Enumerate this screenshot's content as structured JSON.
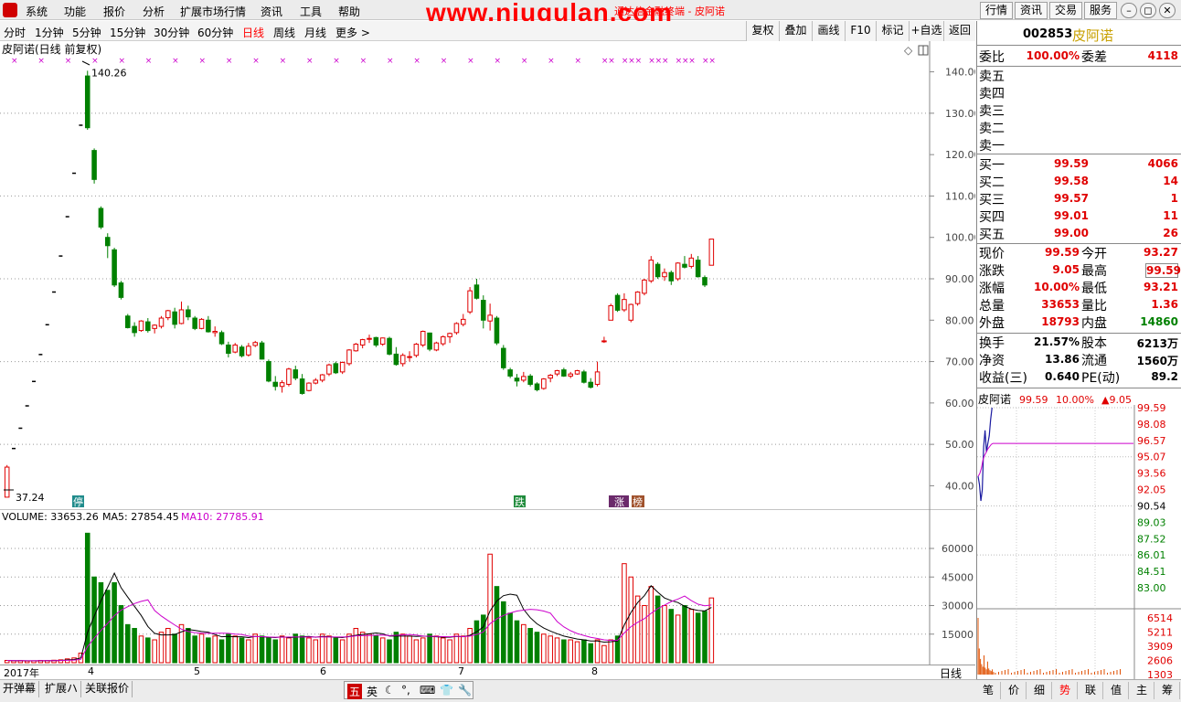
{
  "menubar": {
    "logo_icon": "app-logo-icon",
    "items": [
      "系统",
      "功能",
      "报价",
      "分析",
      "扩展市场行情",
      "资讯",
      "工具",
      "帮助"
    ],
    "watermark": "www.niugulan.com",
    "title_fragment": "通达信金融终端 - 皮阿诺",
    "right_buttons": [
      "行情",
      "资讯",
      "交易",
      "服务"
    ]
  },
  "periodbar": {
    "periods": [
      "分时",
      "1分钟",
      "5分钟",
      "15分钟",
      "30分钟",
      "60分钟",
      "日线",
      "周线",
      "月线",
      "更多 >"
    ],
    "active": "日线",
    "tools": [
      "复权",
      "叠加",
      "画线",
      "F10",
      "标记",
      "+自选",
      "返回"
    ]
  },
  "chart_header": {
    "title": "皮阿诺(日线 前复权)",
    "high_label": "140.26",
    "low_label": "37.24",
    "event_markers": [
      "停",
      "跌",
      "涨",
      "榜"
    ]
  },
  "price_axis": [
    "140.00",
    "130.00",
    "120.00",
    "110.00",
    "100.00",
    "90.00",
    "80.00",
    "70.00",
    "60.00",
    "50.00",
    "40.00"
  ],
  "volume_header": {
    "volume_label": "VOLUME: 33653.26",
    "ma5_label": "MA5: 27854.45",
    "ma10_label": "MA10: 27785.91"
  },
  "volume_axis": [
    "60000",
    "45000",
    "30000",
    "15000"
  ],
  "time_axis": {
    "labels": [
      "2017年",
      "4",
      "5",
      "6",
      "7",
      "8"
    ],
    "period_label": "日线"
  },
  "bottom_tabs": [
    "开弹幕",
    "扩展ハ",
    "关联报价"
  ],
  "ime_bar": {
    "items": [
      "五",
      "英"
    ]
  },
  "quote_panel": {
    "code": "002853",
    "name": "皮阿诺",
    "weibi_label": "委比",
    "weibi": "100.00%",
    "weicha_label": "委差",
    "weicha": "4118",
    "asks": [
      {
        "label": "卖五",
        "price": "",
        "vol": ""
      },
      {
        "label": "卖四",
        "price": "",
        "vol": ""
      },
      {
        "label": "卖三",
        "price": "",
        "vol": ""
      },
      {
        "label": "卖二",
        "price": "",
        "vol": ""
      },
      {
        "label": "卖一",
        "price": "",
        "vol": ""
      }
    ],
    "bids": [
      {
        "label": "买一",
        "price": "99.59",
        "vol": "4066"
      },
      {
        "label": "买二",
        "price": "99.58",
        "vol": "14"
      },
      {
        "label": "买三",
        "price": "99.57",
        "vol": "1"
      },
      {
        "label": "买四",
        "price": "99.01",
        "vol": "11"
      },
      {
        "label": "买五",
        "price": "99.00",
        "vol": "26"
      }
    ],
    "stats": [
      {
        "l1": "现价",
        "v1": "99.59",
        "l2": "今开",
        "v2": "93.27"
      },
      {
        "l1": "涨跌",
        "v1": "9.05",
        "l2": "最高",
        "v2": "99.59"
      },
      {
        "l1": "涨幅",
        "v1": "10.00%",
        "l2": "最低",
        "v2": "93.21"
      },
      {
        "l1": "总量",
        "v1": "33653",
        "l2": "量比",
        "v2": "1.36"
      },
      {
        "l1": "外盘",
        "v1": "18793",
        "l2": "内盘",
        "v2": "14860"
      }
    ],
    "stats2": [
      {
        "l1": "换手",
        "v1": "21.57%",
        "l2": "股本",
        "v2": "6213万"
      },
      {
        "l1": "净资",
        "v1": "13.86",
        "l2": "流通",
        "v2": "1560万"
      },
      {
        "l1": "收益(三)",
        "v1": "0.640",
        "l2": "PE(动)",
        "v2": "89.2"
      }
    ],
    "mini_header": {
      "name": "皮阿诺",
      "price": "99.59",
      "pct": "10.00%",
      "change": "▲9.05"
    },
    "mini_price_axis": [
      "99.59",
      "98.08",
      "96.57",
      "95.07",
      "93.56",
      "92.05",
      "90.54",
      "89.03",
      "87.52",
      "86.01",
      "84.51",
      "83.00"
    ],
    "mini_vol_axis": [
      "6514",
      "5211",
      "3909",
      "2606",
      "1303"
    ],
    "tabs": [
      "笔",
      "价",
      "细",
      "势",
      "联",
      "值",
      "主",
      "筹"
    ],
    "active_tab": "势"
  },
  "chart_data": {
    "type": "candlestick",
    "title": "皮阿诺(日线 前复权)",
    "ylim": [
      37,
      143
    ],
    "volume_ylim": [
      0,
      72000
    ],
    "ohlc": [
      [
        37.24,
        45,
        37.24,
        44.5
      ],
      [
        44.5,
        49,
        44.5,
        49
      ],
      [
        49,
        53.9,
        49,
        53.9
      ],
      [
        53.9,
        59.3,
        53.9,
        59.3
      ],
      [
        59.3,
        65.2,
        59.3,
        65.2
      ],
      [
        65.2,
        71.7,
        65.2,
        71.7
      ],
      [
        71.7,
        78.9,
        71.7,
        78.9
      ],
      [
        78.9,
        86.8,
        78.9,
        86.8
      ],
      [
        86.8,
        95.5,
        86.8,
        95.5
      ],
      [
        95.5,
        105,
        95.5,
        105
      ],
      [
        105,
        115.5,
        105,
        115.5
      ],
      [
        115.5,
        127.1,
        115.5,
        127.1
      ],
      [
        139,
        140.26,
        126,
        126.5
      ],
      [
        121,
        121.5,
        113,
        114
      ],
      [
        107,
        107.5,
        102,
        102.5
      ],
      [
        100,
        101,
        95,
        98
      ],
      [
        97,
        97.5,
        88,
        88.5
      ],
      [
        89,
        89.5,
        85,
        85.5
      ],
      [
        81,
        81.5,
        78,
        78.2
      ],
      [
        78.5,
        79.5,
        76,
        77
      ],
      [
        77.5,
        80,
        77.2,
        79.8
      ],
      [
        79.6,
        80.5,
        77,
        77.5
      ],
      [
        78,
        79,
        76.8,
        78.8
      ],
      [
        78.5,
        81,
        78,
        80.5
      ],
      [
        80.6,
        82.5,
        80,
        82.3
      ],
      [
        82,
        83,
        78,
        79
      ],
      [
        79.2,
        84.5,
        79,
        82.5
      ],
      [
        82.5,
        83.5,
        80,
        80.8
      ],
      [
        80.5,
        81,
        77.6,
        78
      ],
      [
        78,
        80.5,
        77.8,
        80.2
      ],
      [
        80,
        81,
        77,
        77.2
      ],
      [
        77,
        78.5,
        76,
        77.3
      ],
      [
        77,
        77.5,
        74,
        74.3
      ],
      [
        74,
        74.8,
        71,
        72
      ],
      [
        72.3,
        74.5,
        72,
        74
      ],
      [
        73.5,
        74,
        71,
        71.4
      ],
      [
        71.6,
        74.5,
        71.2,
        73.7
      ],
      [
        73.9,
        75,
        73.5,
        74.6
      ],
      [
        74.5,
        75,
        70.5,
        70.6
      ],
      [
        70,
        70.5,
        65,
        65.3
      ],
      [
        65,
        66.5,
        63,
        64
      ],
      [
        64,
        65.5,
        62.5,
        64.9
      ],
      [
        64.5,
        68.5,
        64,
        68.2
      ],
      [
        68,
        69,
        65.5,
        66
      ],
      [
        65.8,
        67,
        62,
        62.3
      ],
      [
        63,
        65,
        62.8,
        64.8
      ],
      [
        64.8,
        66,
        64.5,
        65.5
      ],
      [
        65.5,
        67,
        65,
        66.8
      ],
      [
        67,
        69.5,
        66.5,
        69.2
      ],
      [
        69.5,
        70,
        67,
        67.3
      ],
      [
        67.5,
        70,
        67,
        69.8
      ],
      [
        69.5,
        73,
        69,
        72.8
      ],
      [
        72.6,
        74.5,
        72.4,
        74.2
      ],
      [
        74,
        75.5,
        73.2,
        75.3
      ],
      [
        75.5,
        76.5,
        74.5,
        75.6
      ],
      [
        75.8,
        76,
        73.5,
        74
      ],
      [
        74.2,
        75.8,
        73.8,
        75.7
      ],
      [
        75.6,
        76,
        71.5,
        71.8
      ],
      [
        71.8,
        73.5,
        69,
        69.3
      ],
      [
        69.5,
        72,
        68.8,
        71.5
      ],
      [
        71,
        72.5,
        70,
        71.2
      ],
      [
        71.5,
        74.5,
        71,
        74.2
      ],
      [
        74,
        77.5,
        73.5,
        77.3
      ],
      [
        76.9,
        77,
        72.5,
        73
      ],
      [
        72.8,
        74.8,
        72.5,
        74.5
      ],
      [
        74.3,
        76.3,
        73.8,
        76
      ],
      [
        76,
        77,
        74.5,
        76.8
      ],
      [
        77,
        79.5,
        76.5,
        79.2
      ],
      [
        79,
        81.5,
        78.5,
        80.2
      ],
      [
        82,
        88,
        81.5,
        87.1
      ],
      [
        88.5,
        90,
        85,
        85.3
      ],
      [
        84.8,
        86,
        78,
        80
      ],
      [
        79.8,
        84,
        77.5,
        81.2
      ],
      [
        80.5,
        81,
        74,
        74.5
      ],
      [
        73.2,
        74,
        68,
        68.5
      ],
      [
        68,
        68.5,
        66,
        66.5
      ],
      [
        66,
        67,
        64,
        65.3
      ],
      [
        65.5,
        67.5,
        65,
        66.4
      ],
      [
        66.5,
        67,
        64,
        64.5
      ],
      [
        64.6,
        65,
        62.8,
        63.2
      ],
      [
        63.5,
        66,
        63.2,
        65.8
      ],
      [
        66,
        67,
        65,
        66.7
      ],
      [
        67,
        68,
        66.5,
        67.8
      ],
      [
        68,
        68.5,
        66.3,
        66.5
      ],
      [
        66.5,
        67.5,
        66,
        67
      ],
      [
        67,
        68,
        66.8,
        67.8
      ],
      [
        67.5,
        68,
        64.7,
        65
      ],
      [
        65,
        66,
        63.5,
        63.8
      ],
      [
        64.5,
        70,
        64,
        67.5
      ],
      [
        75,
        76,
        74.5,
        75
      ],
      [
        80,
        84,
        80,
        83.5
      ],
      [
        86,
        86.5,
        82,
        82.4
      ],
      [
        82.5,
        86.5,
        82,
        85
      ],
      [
        80,
        84,
        79.5,
        83.8
      ],
      [
        84,
        87,
        83.5,
        86.8
      ],
      [
        86.5,
        90,
        86,
        89.7
      ],
      [
        89.5,
        95.5,
        89,
        94.5
      ],
      [
        93.5,
        94,
        90,
        90.5
      ],
      [
        90.5,
        92.5,
        89.5,
        91.5
      ],
      [
        91.5,
        92,
        88.5,
        89.5
      ],
      [
        90,
        94,
        89.5,
        93.8
      ],
      [
        93.5,
        95.5,
        92.5,
        92.8
      ],
      [
        93,
        96,
        92.5,
        95
      ],
      [
        94.5,
        95.5,
        90.3,
        90.5
      ],
      [
        90.3,
        90.8,
        88,
        88.5
      ],
      [
        93.27,
        99.59,
        93.21,
        99.59
      ]
    ],
    "volume": [
      1200,
      1000,
      1100,
      900,
      1000,
      1200,
      1100,
      1300,
      1500,
      2000,
      2500,
      5000,
      68000,
      45000,
      42000,
      38000,
      42000,
      30000,
      20000,
      18000,
      14000,
      13000,
      12000,
      16000,
      18000,
      15000,
      20000,
      18000,
      14000,
      15000,
      13000,
      14000,
      12000,
      15000,
      14000,
      13000,
      12000,
      15000,
      14000,
      13000,
      12000,
      14000,
      13000,
      15000,
      14000,
      13000,
      12000,
      15000,
      14000,
      13000,
      12000,
      15000,
      18000,
      16000,
      15000,
      14000,
      13000,
      12000,
      16000,
      15000,
      14000,
      12000,
      13000,
      15000,
      14000,
      13000,
      12000,
      15000,
      14000,
      18000,
      22000,
      25000,
      57000,
      40000,
      32000,
      26000,
      22000,
      20000,
      18000,
      16000,
      15000,
      14000,
      13000,
      12000,
      12000,
      11000,
      12000,
      10000,
      12000,
      9000,
      12000,
      14000,
      52000,
      45000,
      35000,
      30000,
      40000,
      35000,
      30000,
      28000,
      25000,
      30000,
      28000,
      26000,
      27000,
      34000
    ],
    "ma5_note": "",
    "price_ticks": [
      140,
      130,
      120,
      110,
      100,
      90,
      80,
      70,
      60,
      50,
      40
    ],
    "volume_ticks": [
      60000,
      45000,
      30000,
      15000
    ],
    "intraday": {
      "ylim": [
        83.0,
        99.59
      ],
      "price_line": [
        93.27,
        92.5,
        91.0,
        92.0,
        96.0,
        97.5,
        95.5,
        96.3,
        97.0,
        98.5,
        99.59
      ],
      "avg_line": [
        93.27,
        93.5,
        94.0,
        94.8,
        95.2,
        95.5,
        95.8,
        96.0,
        96.2,
        96.3
      ],
      "volume": [
        6514,
        3000,
        1800,
        1200,
        900,
        2200,
        800,
        600,
        1500,
        700,
        500,
        400,
        600,
        300
      ]
    }
  }
}
